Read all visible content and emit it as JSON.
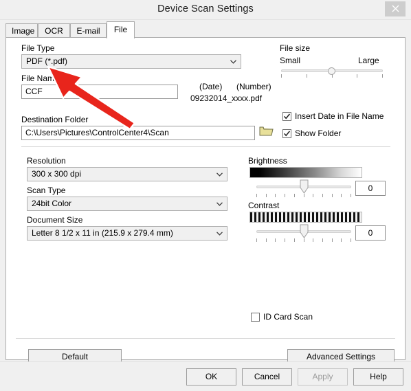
{
  "window": {
    "title": "Device Scan Settings",
    "close_icon": "close-icon"
  },
  "tabs": [
    {
      "label": "Image",
      "active": false
    },
    {
      "label": "OCR",
      "active": false
    },
    {
      "label": "E-mail",
      "active": false
    },
    {
      "label": "File",
      "active": true
    }
  ],
  "file_section": {
    "file_type_label": "File Type",
    "file_type_value": "PDF (*.pdf)",
    "file_name_label": "File Name",
    "file_name_value": "CCF",
    "date_label": "(Date)",
    "number_label": "(Number)",
    "sample_filename": "09232014_xxxx.pdf",
    "destination_label": "Destination Folder",
    "destination_value": "C:\\Users\\Pictures\\ControlCenter4\\Scan",
    "browse_icon": "folder-icon"
  },
  "file_size": {
    "label": "File size",
    "min_label": "Small",
    "max_label": "Large",
    "value_percent": 50
  },
  "options": [
    {
      "label": "Insert Date in File Name",
      "checked": true
    },
    {
      "label": "Show Folder",
      "checked": true
    }
  ],
  "scan_settings": {
    "resolution_label": "Resolution",
    "resolution_value": "300 x 300 dpi",
    "scan_type_label": "Scan Type",
    "scan_type_value": "24bit Color",
    "document_size_label": "Document Size",
    "document_size_value": "Letter 8 1/2 x 11 in (215.9 x 279.4 mm)"
  },
  "brightness": {
    "label": "Brightness",
    "value": "0",
    "slider_percent": 50
  },
  "contrast": {
    "label": "Contrast",
    "value": "0",
    "slider_percent": 50
  },
  "id_card_scan": {
    "label": "ID Card Scan",
    "checked": false
  },
  "panel_buttons": {
    "default_label": "Default",
    "advanced_label": "Advanced Settings"
  },
  "footer_buttons": [
    {
      "label": "OK",
      "disabled": false
    },
    {
      "label": "Cancel",
      "disabled": false
    },
    {
      "label": "Apply",
      "disabled": true
    },
    {
      "label": "Help",
      "disabled": false
    }
  ],
  "annotation": {
    "name": "red-arrow-annotation",
    "color": "#e8251c",
    "points_to": "file-type-combo"
  }
}
